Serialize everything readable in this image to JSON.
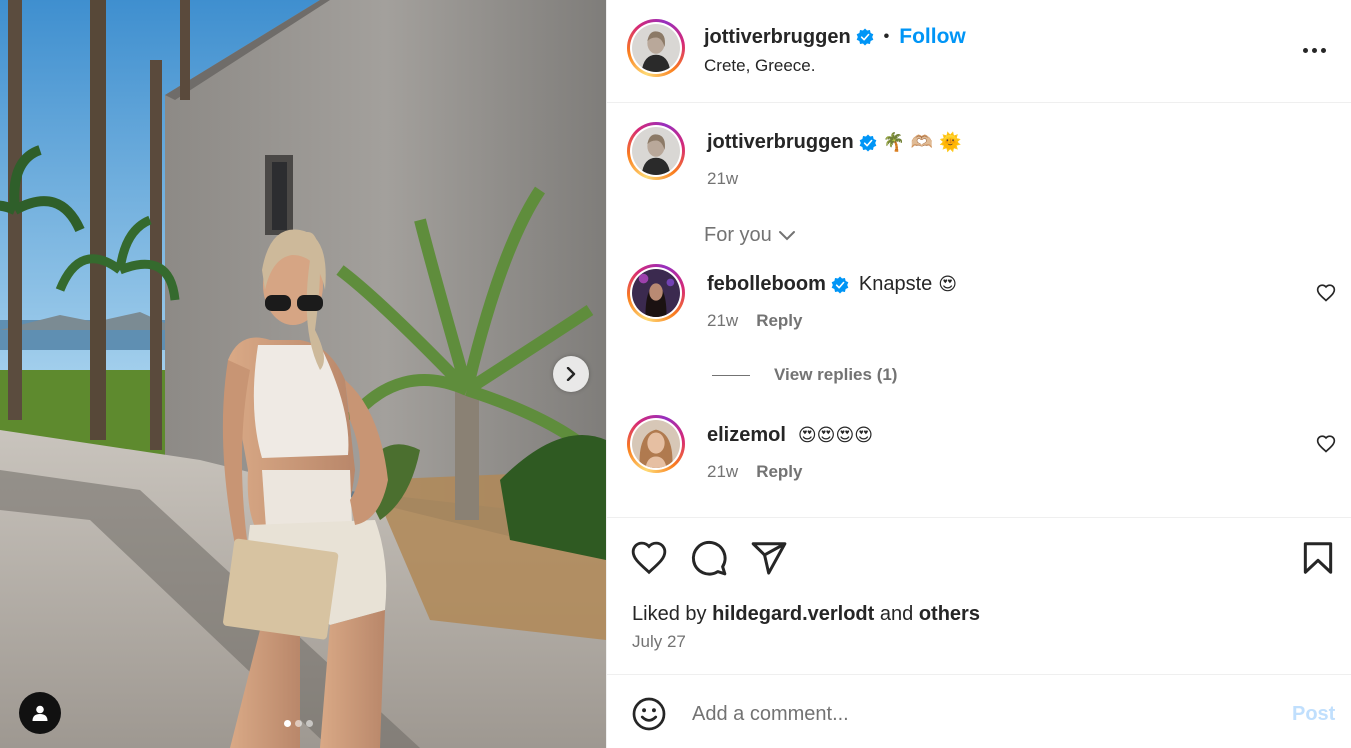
{
  "post": {
    "author": {
      "username": "jottiverbruggen",
      "verified": true,
      "avatar_icon": "profile-photo"
    },
    "follow_label": "Follow",
    "separator": "•",
    "location": "Crete, Greece.",
    "more_icon": "more-horizontal-icon",
    "caption": {
      "username": "jottiverbruggen",
      "emojis": "🌴 🫶🏼 🌞",
      "time": "21w"
    },
    "carousel": {
      "current": 1,
      "total": 3,
      "next_icon": "chevron-right-icon",
      "tag_icon": "user-tag-icon"
    }
  },
  "comments_filter": {
    "label": "For you",
    "icon": "chevron-down-icon"
  },
  "comments": [
    {
      "username": "febolleboom",
      "verified": true,
      "text": "Knapste",
      "emojis": "😍",
      "time": "21w",
      "reply_label": "Reply",
      "view_replies": "View replies (1)"
    },
    {
      "username": "elizemol",
      "verified": false,
      "text": "",
      "emojis": "😍😍😍😍",
      "time": "21w",
      "reply_label": "Reply"
    }
  ],
  "actions": {
    "icons": [
      "heart-icon",
      "comment-icon",
      "share-icon",
      "bookmark-icon"
    ]
  },
  "likes": {
    "prefix": "Liked by",
    "user": "hildegard.verlodt",
    "conjunction": "and",
    "others": "others"
  },
  "date": "July 27",
  "add_comment": {
    "placeholder": "Add a comment...",
    "post_label": "Post",
    "emoji_icon": "smiley-icon"
  },
  "colors": {
    "accent": "#0095f6",
    "verified": "#0095f6",
    "muted": "#737373",
    "post_disabled": "#c0dffd"
  }
}
